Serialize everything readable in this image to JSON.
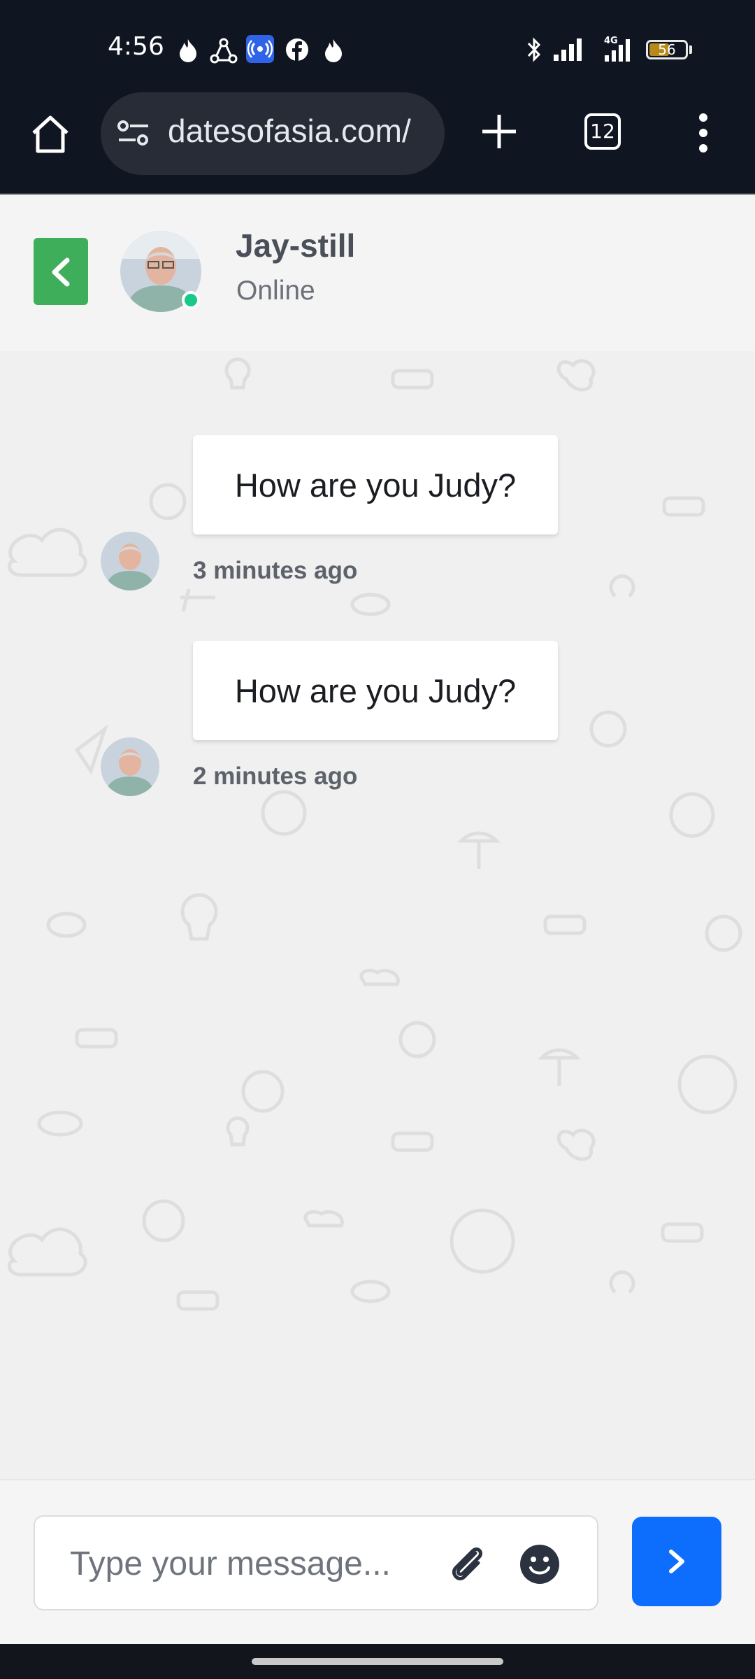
{
  "status_bar": {
    "time": "4:56",
    "battery_percent": 56,
    "battery_label": "56",
    "network_label": "4G",
    "icons": [
      "flame-icon",
      "share-icon",
      "broadcast-icon",
      "facebook-icon",
      "flame-icon",
      "bluetooth-icon",
      "signal-icon",
      "signal-4g-icon",
      "battery-icon"
    ]
  },
  "browser": {
    "url": "datesofasia.com/",
    "tab_count": "12",
    "icons": [
      "home-icon",
      "site-settings-icon",
      "plus-icon",
      "tabs-icon",
      "overflow-menu-icon"
    ]
  },
  "chat_header": {
    "name": "Jay-still",
    "status": "Online",
    "status_color": "#17c98a",
    "back_button_color": "#3fae5a"
  },
  "messages": [
    {
      "text": "How are you Judy?",
      "time": "3 minutes ago"
    },
    {
      "text": "How are you Judy?",
      "time": "2 minutes ago"
    }
  ],
  "composer": {
    "placeholder": "Type your message...",
    "value": "",
    "send_button_color": "#0d6efd",
    "icons": [
      "attach-icon",
      "emoji-icon",
      "send-icon"
    ]
  }
}
